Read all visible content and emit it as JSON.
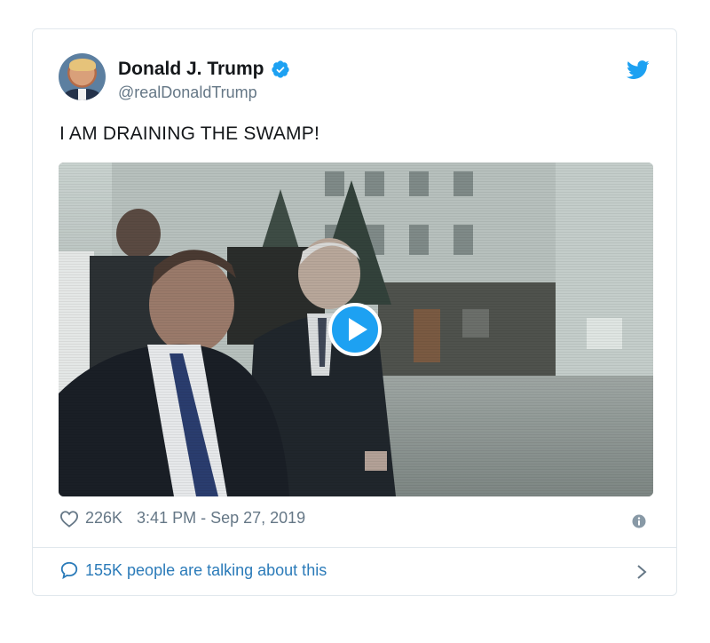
{
  "tweet": {
    "author_name": "Donald J. Trump",
    "author_handle": "@realDonaldTrump",
    "verified": true,
    "text": "I AM DRAINING THE SWAMP!",
    "likes": "226K",
    "timestamp": "3:41 PM - Sep 27, 2019",
    "talking_about": "155K people are talking about this"
  },
  "media": {
    "type": "video",
    "play_icon": "play-icon"
  },
  "icons": {
    "verified": "verified-badge-icon",
    "brand": "twitter-bird-icon",
    "like": "heart-icon",
    "info": "info-icon",
    "reply": "speech-bubble-icon",
    "more": "chevron-right-icon"
  },
  "colors": {
    "brand_blue": "#1da1f2",
    "link_blue": "#2b7bb9",
    "muted_text": "#657786",
    "border": "#e1e8ed"
  }
}
